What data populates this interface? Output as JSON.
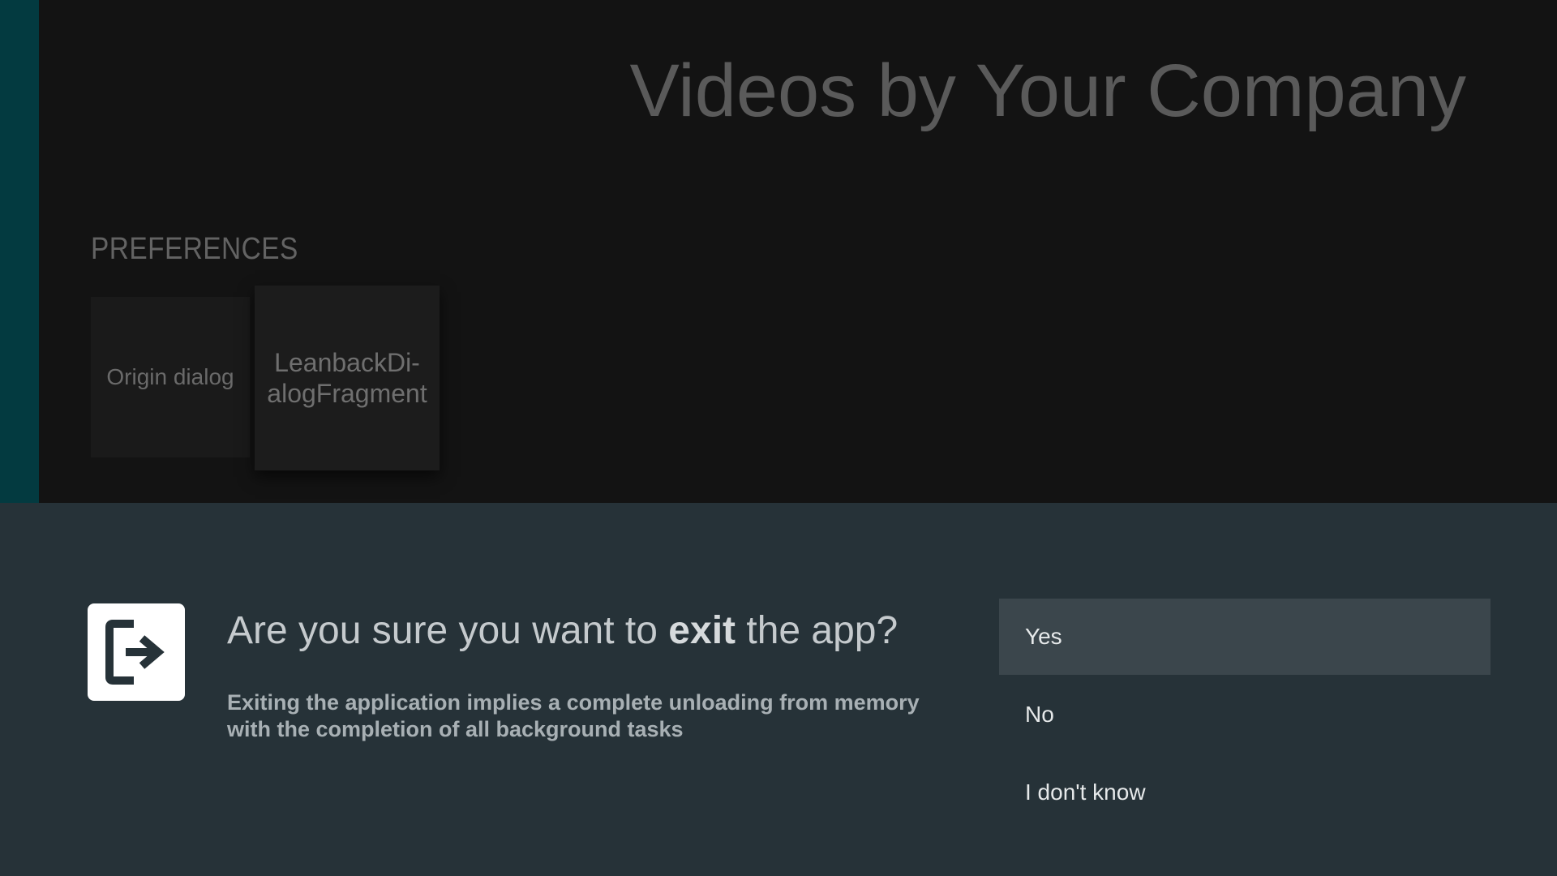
{
  "browse": {
    "title": "Videos by Your Company",
    "row_header": "PREFERENCES",
    "cards": [
      {
        "label": "Origin dialog"
      },
      {
        "label": "LeanbackDi-\nalogFragment"
      }
    ]
  },
  "dialog": {
    "icon": "exit-to-app-icon",
    "title_prefix": "Are you sure you want to ",
    "title_emphasis": "exit",
    "title_suffix": " the app?",
    "description": "Exiting the application implies a complete unloading from memory with the completion of all background tasks",
    "actions": [
      {
        "label": "Yes",
        "selected": true
      },
      {
        "label": "No",
        "selected": false
      },
      {
        "label": "I don't know",
        "selected": false
      }
    ]
  },
  "colors": {
    "side_strip": "#033a40",
    "dialog_background": "#263238",
    "selected_action": "#3b464c"
  }
}
